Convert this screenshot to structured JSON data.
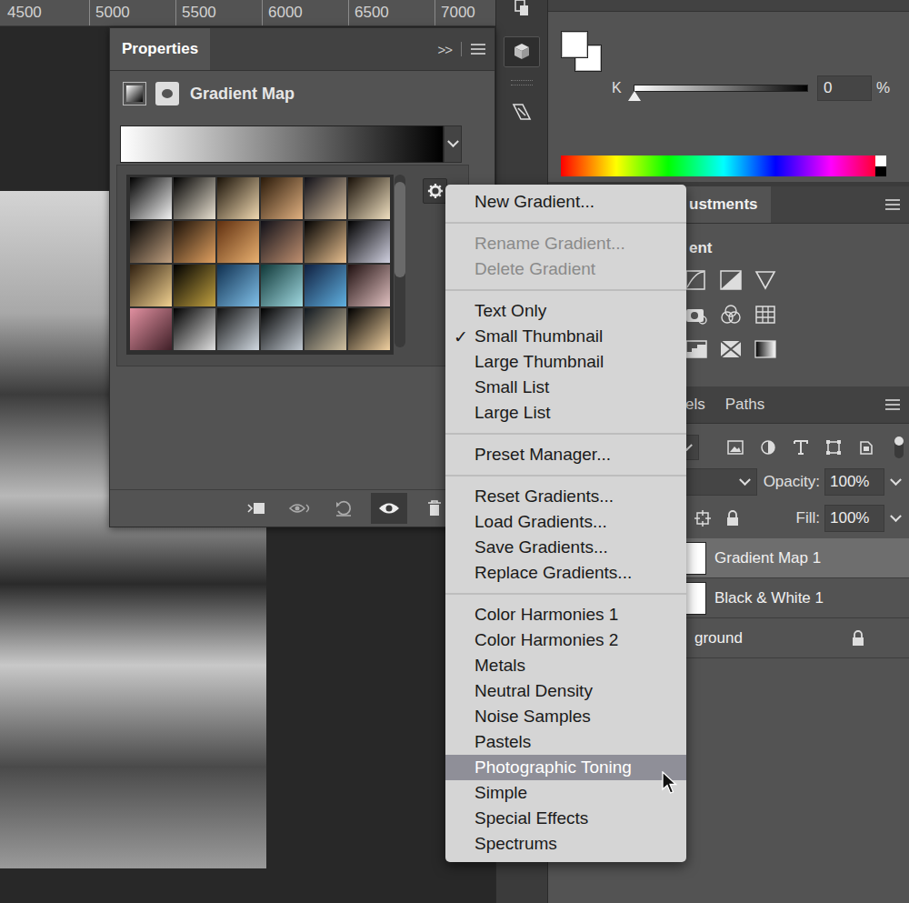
{
  "ruler": {
    "ticks": [
      "4500",
      "5000",
      "5500",
      "6000",
      "6500",
      "7000"
    ]
  },
  "properties": {
    "title": "Properties",
    "expand": ">>",
    "adjustment": "Gradient Map",
    "gradient": [
      "#ffffff",
      "#000000"
    ],
    "presets": [
      {
        "colors": [
          "#000000",
          "#f2f2f2"
        ],
        "selected": false
      },
      {
        "colors": [
          "#000000",
          "#e8e0d0"
        ],
        "selected": false
      },
      {
        "colors": [
          "#1a1208",
          "#f0d8b0"
        ],
        "selected": false
      },
      {
        "colors": [
          "#2a1a0a",
          "#e0b080"
        ],
        "selected": false
      },
      {
        "colors": [
          "#101018",
          "#d8c0a0"
        ],
        "selected": false
      },
      {
        "colors": [
          "#181008",
          "#f0e0c0"
        ],
        "selected": false
      },
      {
        "colors": [
          "#000000",
          "#c0a080"
        ],
        "selected": false
      },
      {
        "colors": [
          "#1a1008",
          "#e0a060"
        ],
        "selected": false
      },
      {
        "colors": [
          "#603010",
          "#e8b070"
        ],
        "selected": false
      },
      {
        "colors": [
          "#101018",
          "#c09070"
        ],
        "selected": false
      },
      {
        "colors": [
          "#000000",
          "#e8c090"
        ],
        "selected": false
      },
      {
        "colors": [
          "#000000",
          "#d0d0e0"
        ],
        "selected": false
      },
      {
        "colors": [
          "#302010",
          "#f0d090"
        ],
        "selected": false
      },
      {
        "colors": [
          "#000000",
          "#c0a040"
        ],
        "selected": false
      },
      {
        "colors": [
          "#103050",
          "#80c0e8"
        ],
        "selected": false
      },
      {
        "colors": [
          "#103838",
          "#a0d8e0"
        ],
        "selected": false
      },
      {
        "colors": [
          "#102040",
          "#60b0e0"
        ],
        "selected": false
      },
      {
        "colors": [
          "#201010",
          "#e0c0c0"
        ],
        "selected": false
      },
      {
        "colors": [
          "#e090a0",
          "#402028"
        ],
        "selected": false
      },
      {
        "colors": [
          "#000000",
          "#e0e0e0"
        ],
        "selected": false
      },
      {
        "colors": [
          "#101010",
          "#d0d8e0"
        ],
        "selected": false
      },
      {
        "colors": [
          "#000000",
          "#c0c8d0"
        ],
        "selected": false
      },
      {
        "colors": [
          "#101820",
          "#d0c0a0"
        ],
        "selected": false
      },
      {
        "colors": [
          "#000000",
          "#f0d0a0"
        ],
        "selected": false
      }
    ],
    "scrollbar": {
      "level": 0.55
    }
  },
  "color": {
    "channel": "K",
    "value": "0",
    "unit": "%",
    "level": 0,
    "foreground": "#ffffff",
    "background": "#ffffff"
  },
  "adjustments": {
    "tab": "ustments",
    "hint": "ent"
  },
  "layers_panel": {
    "tabs": [
      {
        "label": "els",
        "selected": false
      },
      {
        "label": "Paths",
        "selected": false
      }
    ],
    "opacity": {
      "label": "Opacity:",
      "value": "100%"
    },
    "fill": {
      "label": "Fill:",
      "value": "100%"
    },
    "layers": [
      {
        "name": "Gradient Map 1",
        "selected": true,
        "locked": false,
        "thumbnail": true
      },
      {
        "name": "Black & White 1",
        "selected": false,
        "locked": false,
        "thumbnail": true
      },
      {
        "name": "ground",
        "selected": false,
        "locked": true,
        "thumbnail": false
      }
    ]
  },
  "menu": {
    "check": "✓",
    "groups": [
      [
        {
          "label": "New Gradient...",
          "checked": false,
          "disabled": false,
          "selected": false
        }
      ],
      [
        {
          "label": "Rename Gradient...",
          "checked": false,
          "disabled": true,
          "selected": false
        },
        {
          "label": "Delete Gradient",
          "checked": false,
          "disabled": true,
          "selected": false
        }
      ],
      [
        {
          "label": "Text Only",
          "checked": false,
          "disabled": false,
          "selected": false
        },
        {
          "label": "Small Thumbnail",
          "checked": true,
          "disabled": false,
          "selected": false
        },
        {
          "label": "Large Thumbnail",
          "checked": false,
          "disabled": false,
          "selected": false
        },
        {
          "label": "Small List",
          "checked": false,
          "disabled": false,
          "selected": false
        },
        {
          "label": "Large List",
          "checked": false,
          "disabled": false,
          "selected": false
        }
      ],
      [
        {
          "label": "Preset Manager...",
          "checked": false,
          "disabled": false,
          "selected": false
        }
      ],
      [
        {
          "label": "Reset Gradients...",
          "checked": false,
          "disabled": false,
          "selected": false
        },
        {
          "label": "Load Gradients...",
          "checked": false,
          "disabled": false,
          "selected": false
        },
        {
          "label": "Save Gradients...",
          "checked": false,
          "disabled": false,
          "selected": false
        },
        {
          "label": "Replace Gradients...",
          "checked": false,
          "disabled": false,
          "selected": false
        }
      ],
      [
        {
          "label": "Color Harmonies 1",
          "checked": false,
          "disabled": false,
          "selected": false
        },
        {
          "label": "Color Harmonies 2",
          "checked": false,
          "disabled": false,
          "selected": false
        },
        {
          "label": "Metals",
          "checked": false,
          "disabled": false,
          "selected": false
        },
        {
          "label": "Neutral Density",
          "checked": false,
          "disabled": false,
          "selected": false
        },
        {
          "label": "Noise Samples",
          "checked": false,
          "disabled": false,
          "selected": false
        },
        {
          "label": "Pastels",
          "checked": false,
          "disabled": false,
          "selected": false
        },
        {
          "label": "Photographic Toning",
          "checked": false,
          "disabled": false,
          "selected": true
        },
        {
          "label": "Simple",
          "checked": false,
          "disabled": false,
          "selected": false
        },
        {
          "label": "Special Effects",
          "checked": false,
          "disabled": false,
          "selected": false
        },
        {
          "label": "Spectrums",
          "checked": false,
          "disabled": false,
          "selected": false
        }
      ]
    ]
  }
}
